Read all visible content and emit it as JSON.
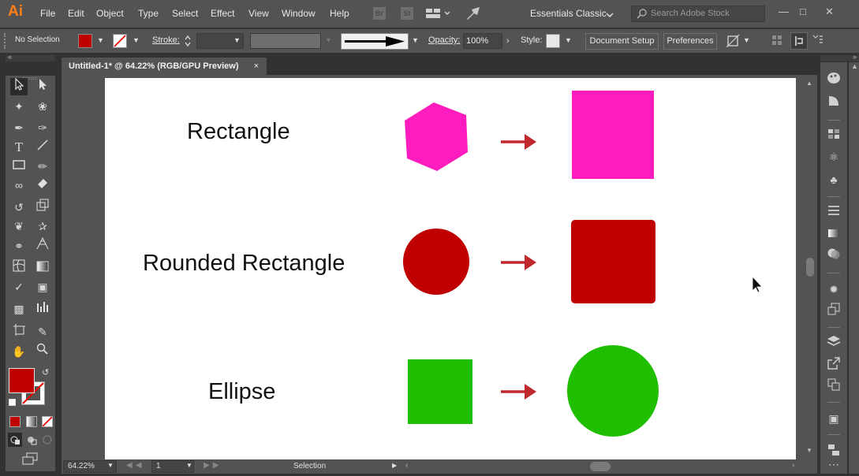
{
  "app": {
    "logo": "Ai",
    "menus": [
      "File",
      "Edit",
      "Object",
      "Type",
      "Select",
      "Effect",
      "View",
      "Window",
      "Help"
    ],
    "bridge_label": "Br",
    "stock_label": "St",
    "workspace": "Essentials Classic",
    "search_placeholder": "Search Adobe Stock"
  },
  "control_bar": {
    "selection_status": "No Selection",
    "stroke_label": "Stroke:",
    "opacity_label": "Opacity:",
    "opacity_value": "100%",
    "style_label": "Style:",
    "document_setup": "Document Setup",
    "preferences": "Preferences",
    "fill_color": "#c00000"
  },
  "document": {
    "tab_title": "Untitled-1* @ 64.22% (RGB/GPU Preview)",
    "close_glyph": "×"
  },
  "artboard": {
    "rows": [
      {
        "label": "Rectangle",
        "source_shape": "hexagon",
        "source_color": "#ff1cbe",
        "target_shape": "rectangle",
        "target_color": "#ff1cbe"
      },
      {
        "label": "Rounded Rectangle",
        "source_shape": "circle",
        "source_color": "#c00000",
        "target_shape": "rounded-rectangle",
        "target_color": "#c00000"
      },
      {
        "label": "Ellipse",
        "source_shape": "square",
        "source_color": "#1fbf00",
        "target_shape": "circle",
        "target_color": "#1fbf00"
      }
    ],
    "arrow_color": "#c0282d"
  },
  "status_bar": {
    "zoom": "64.22%",
    "artboard_number": "1",
    "tool_status": "Selection"
  }
}
